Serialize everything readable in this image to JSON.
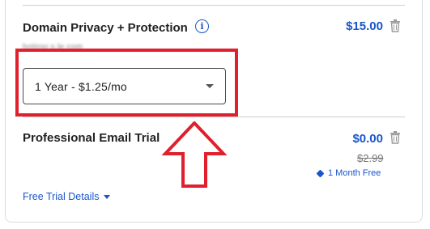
{
  "items": [
    {
      "title": "Domain Privacy + Protection",
      "domain": "hotinsr.s.le.com",
      "price": "$15.00",
      "term_select": {
        "value": "1 Year - $1.25/mo"
      }
    },
    {
      "title": "Professional Email Trial",
      "price": "$0.00",
      "original_price": "$2.99",
      "promo": "1 Month Free",
      "details_link": "Free Trial Details"
    }
  ],
  "icons": {
    "info": "info-icon",
    "trash": "trash-icon",
    "tag": "tag-icon",
    "caret": "chevron-down-icon",
    "annotation_arrow": "up-arrow-icon"
  },
  "colors": {
    "accent": "#1a56c9",
    "annotation": "#e0202c"
  }
}
